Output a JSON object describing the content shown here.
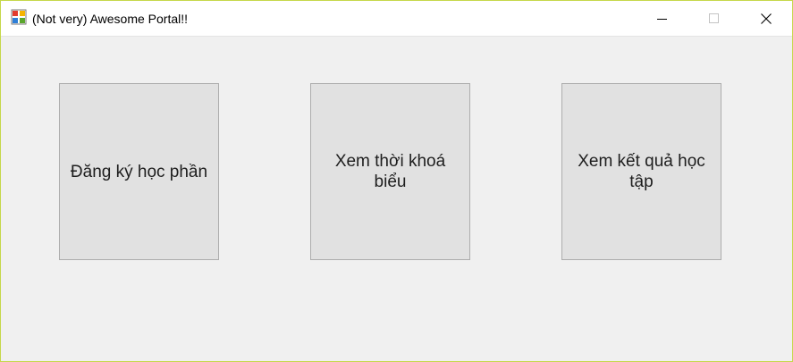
{
  "window": {
    "title": "(Not very) Awesome Portal!!",
    "icon": "windows-forms-app-icon",
    "controls": [
      "minimize-icon",
      "maximize-icon",
      "close-icon"
    ]
  },
  "buttons": [
    {
      "label": "Đăng ký học phần"
    },
    {
      "label": "Xem thời khoá biểu"
    },
    {
      "label": "Xem kết quả học tập"
    }
  ],
  "colors": {
    "window_border": "#c6d84a",
    "client_background": "#f0f0f0",
    "button_face": "#e1e1e1",
    "button_border": "#adadad"
  }
}
